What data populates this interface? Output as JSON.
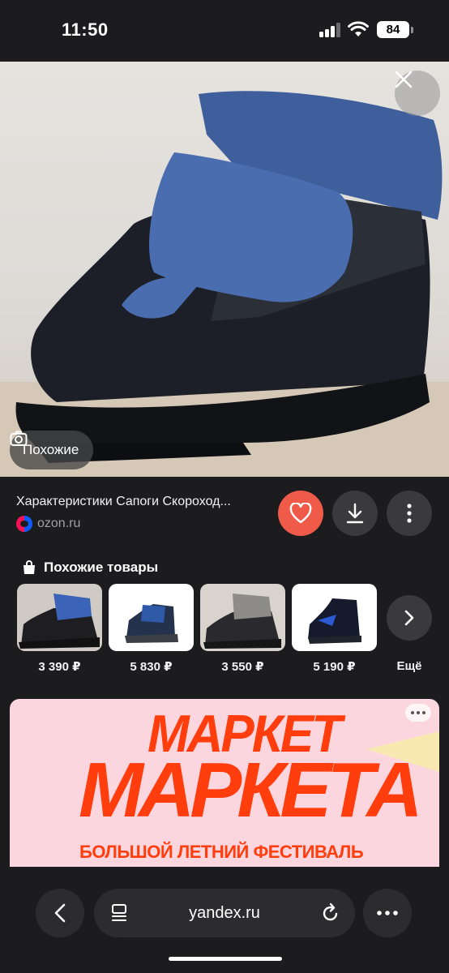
{
  "status_bar": {
    "time": "11:50",
    "battery": "84"
  },
  "hero": {
    "similar_label": "Похожие"
  },
  "result": {
    "title": "Характеристики Сапоги Скороход...",
    "source": "ozon.ru"
  },
  "similar_products": {
    "header": "Похожие товары",
    "items": [
      {
        "price": "3 390 ₽"
      },
      {
        "price": "5 830 ₽"
      },
      {
        "price": "3 550 ₽"
      },
      {
        "price": "5 190 ₽"
      }
    ],
    "more_label": "Ещё"
  },
  "ad": {
    "line1": "МАРКЕТ",
    "line2": "МАРКЕТА",
    "tagline": "БОЛЬШОЙ ЛЕТНИЙ ФЕСТИВАЛЬ"
  },
  "browser": {
    "url": "yandex.ru"
  },
  "colors": {
    "like": "#f05a48",
    "ad_bg": "#fcd6df",
    "ad_text": "#ff3d0d",
    "background": "#1c1c1e"
  }
}
